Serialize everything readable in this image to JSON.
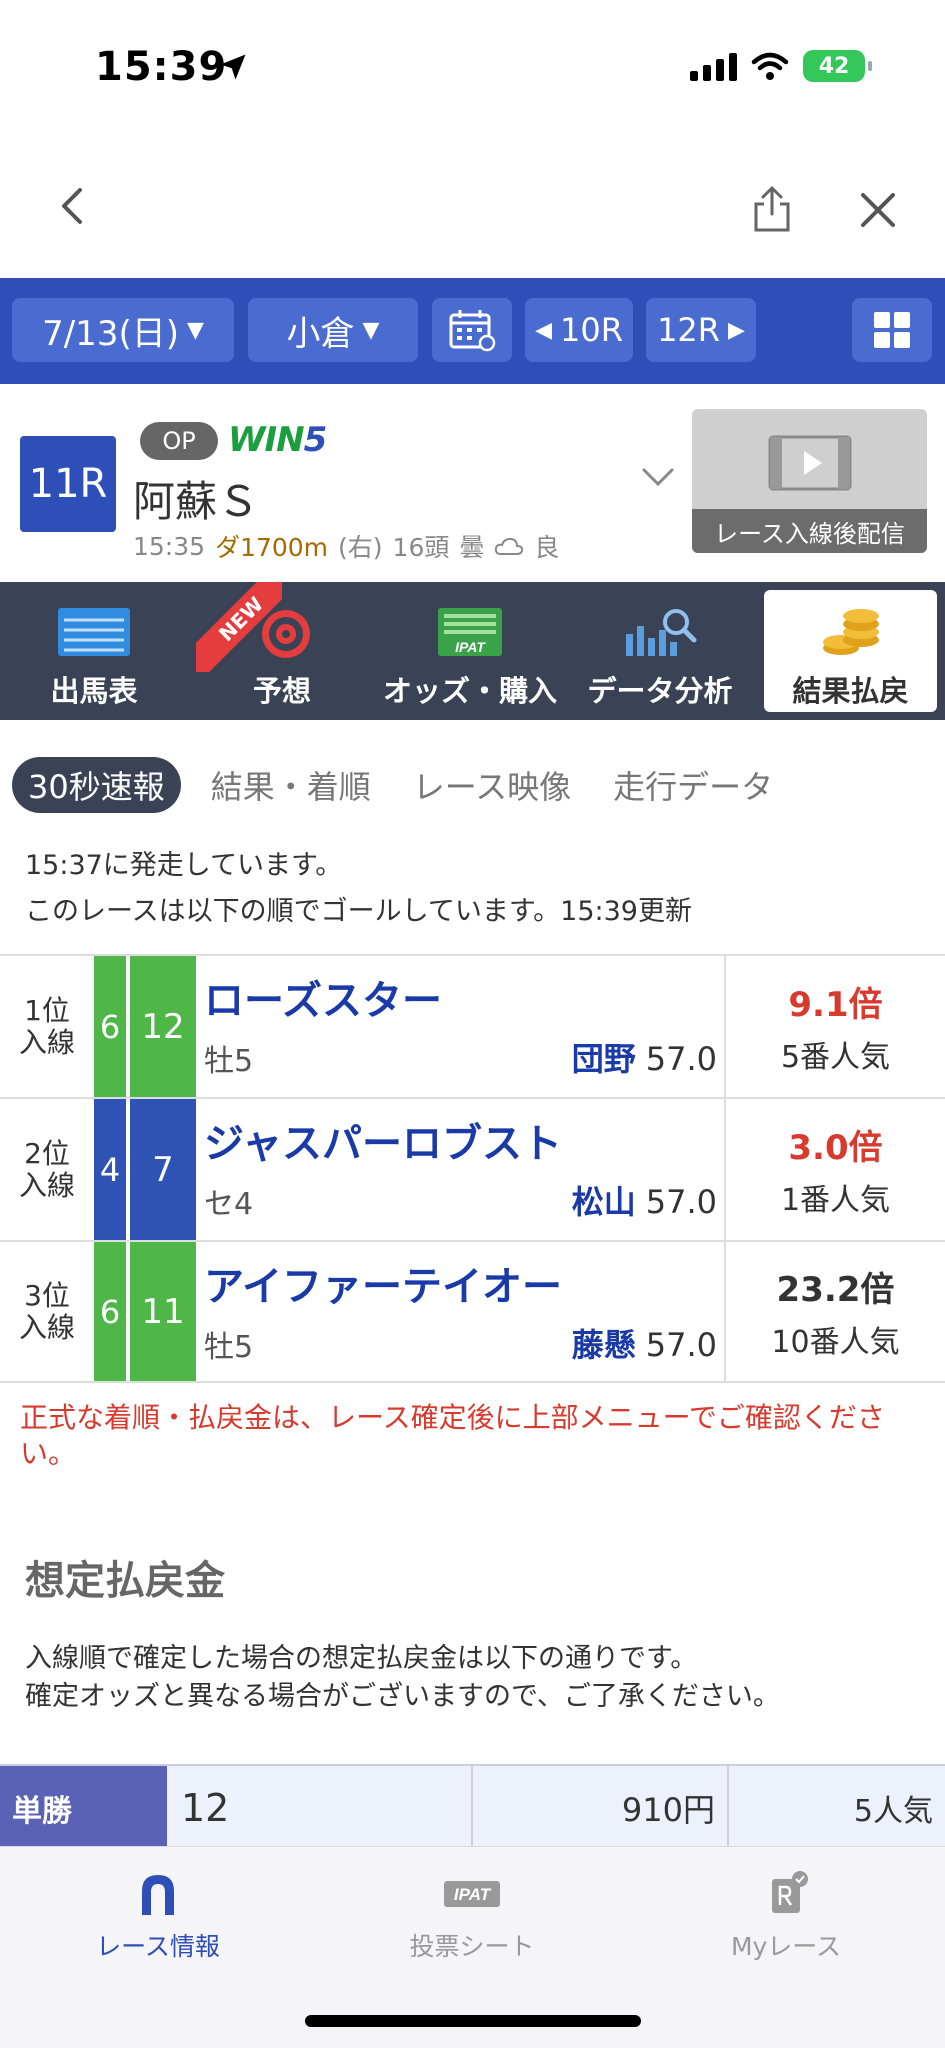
{
  "status": {
    "time": "15:39",
    "battery": "42"
  },
  "nav": {
    "date": "7/13(日)",
    "venue": "小倉",
    "prev_race": "10R",
    "next_race": "12R"
  },
  "race": {
    "number": "11R",
    "grade": "OP",
    "win5_a": "WIN",
    "win5_b": "5",
    "name": "阿蘇Ｓ",
    "start_time": "15:35",
    "course": "ダ1700m",
    "direction": "(右)",
    "runners": "16頭",
    "weather": "曇",
    "track": "良",
    "video_label": "レース入線後配信"
  },
  "menu": {
    "card": "出馬表",
    "new_badge": "NEW",
    "prediction": "予想",
    "odds": "オッズ・購入",
    "analysis": "データ分析",
    "results": "結果払戻"
  },
  "sub_tabs": [
    "30秒速報",
    "結果・着順",
    "レース映像",
    "走行データ"
  ],
  "notice": {
    "line1": "15:37に発走しています。",
    "line2": "このレースは以下の順でゴールしています。15:39更新"
  },
  "results": [
    {
      "rank_a": "1位",
      "rank_b": "入線",
      "frame": "6",
      "number": "12",
      "name": "ローズスター",
      "sex_age": "牡5",
      "jockey": "団野",
      "weight": "57.0",
      "odds": "9.1倍",
      "popularity": "5番人気",
      "frame_color": "#4fb648",
      "odds_color": "#d93a2e"
    },
    {
      "rank_a": "2位",
      "rank_b": "入線",
      "frame": "4",
      "number": "7",
      "name": "ジャスパーロブスト",
      "sex_age": "セ4",
      "jockey": "松山",
      "weight": "57.0",
      "odds": "3.0倍",
      "popularity": "1番人気",
      "frame_color": "#2f52b5",
      "odds_color": "#d93a2e"
    },
    {
      "rank_a": "3位",
      "rank_b": "入線",
      "frame": "6",
      "number": "11",
      "name": "アイファーテイオー",
      "sex_age": "牡5",
      "jockey": "藤懸",
      "weight": "57.0",
      "odds": "23.2倍",
      "popularity": "10番人気",
      "frame_color": "#4fb648",
      "odds_color": "#333333"
    }
  ],
  "warning": "正式な着順・払戻金は、レース確定後に上部メニューでご確認ください。",
  "payout": {
    "title": "想定払戻金",
    "desc1": "入線順で確定した場合の想定払戻金は以下の通りです。",
    "desc2": "確定オッズと異なる場合がございますので、ご了承ください。",
    "rows": [
      {
        "type": "単勝",
        "combo": "12",
        "amount": "910円",
        "popularity": "5人気"
      }
    ]
  },
  "tabbar": {
    "race_info": "レース情報",
    "ipat_icon": "IPAT",
    "sheet": "投票シート",
    "my_race": "Myレース"
  }
}
